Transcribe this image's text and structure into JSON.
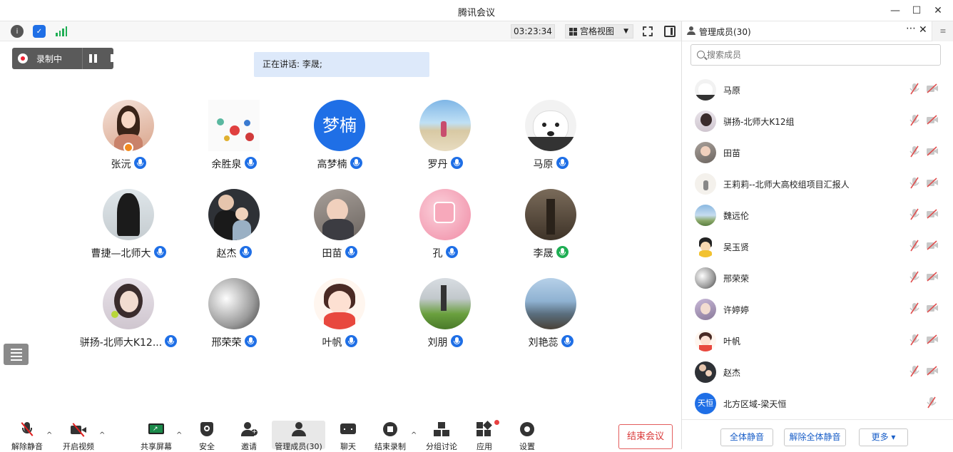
{
  "window": {
    "title": "腾讯会议",
    "min": "—",
    "max": "☐",
    "close": "✕"
  },
  "top_toolbar": {
    "timer": "03:23:34",
    "view_label": "宫格视图"
  },
  "recording": {
    "label": "录制中"
  },
  "speaking": {
    "text": "正在讲话: 李晟;"
  },
  "participants": [
    {
      "name": "张沅",
      "mic": "blue"
    },
    {
      "name": "余胜泉",
      "mic": "blue"
    },
    {
      "name": "高梦楠",
      "mic": "blue",
      "avatar_text": "梦楠"
    },
    {
      "name": "罗丹",
      "mic": "blue"
    },
    {
      "name": "马原",
      "mic": "blue"
    },
    {
      "name": "曹捷—北师大",
      "mic": "blue"
    },
    {
      "name": "赵杰",
      "mic": "blue"
    },
    {
      "name": "田苗",
      "mic": "blue"
    },
    {
      "name": "孔",
      "mic": "blue"
    },
    {
      "name": "李晟",
      "mic": "green"
    },
    {
      "name": "骈扬-北师大K12...",
      "mic": "blue"
    },
    {
      "name": "邢荣荣",
      "mic": "blue"
    },
    {
      "name": "叶帆",
      "mic": "blue"
    },
    {
      "name": "刘朋",
      "mic": "blue"
    },
    {
      "name": "刘艳蕊",
      "mic": "blue"
    }
  ],
  "bottom_bar": {
    "unmute": "解除静音",
    "start_video": "开启视频",
    "share_screen": "共享屏幕",
    "security": "安全",
    "invite": "邀请",
    "manage_members": "管理成员(30)",
    "chat": "聊天",
    "stop_recording": "结束录制",
    "breakout": "分组讨论",
    "apps": "应用",
    "settings": "设置",
    "end_meeting": "结束会议"
  },
  "side_panel": {
    "title": "管理成员(30)",
    "more": "⋯",
    "close": "✕",
    "search_placeholder": "搜索成员",
    "members": [
      {
        "name": "马原"
      },
      {
        "name": "骈扬-北师大K12组"
      },
      {
        "name": "田苗"
      },
      {
        "name": "王莉莉--北师大高校组项目汇报人"
      },
      {
        "name": "魏远伦"
      },
      {
        "name": "吴玉贤"
      },
      {
        "name": "邢荣荣"
      },
      {
        "name": "许婷婷"
      },
      {
        "name": "叶帆"
      },
      {
        "name": "赵杰"
      },
      {
        "name": "北方区域-梁天恒",
        "avatar_text": "天恒"
      }
    ],
    "mute_all": "全体静音",
    "unmute_all": "解除全体静音",
    "more_btn": "更多 ▾"
  },
  "colors": {
    "accent": "#1f6fe6",
    "speaking_green": "#1fae54",
    "end_red": "#d93838"
  }
}
